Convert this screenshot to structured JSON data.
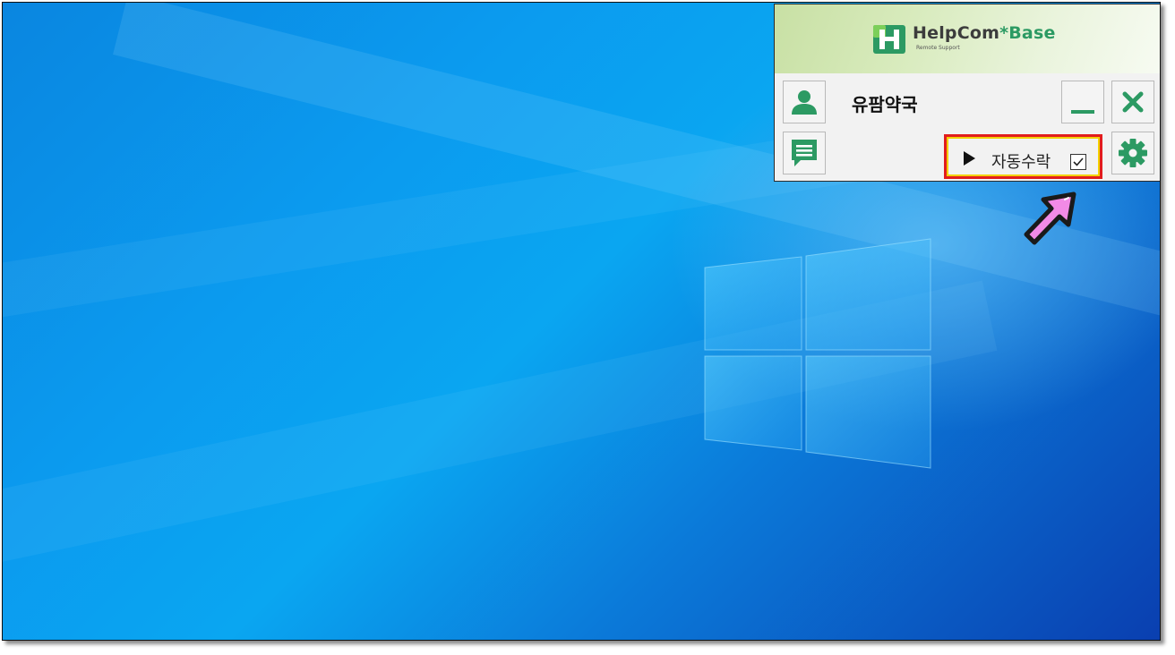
{
  "desktop": {
    "wallpaper": "windows-10-hero",
    "colors": {
      "base": "#0a9cef",
      "deep": "#0a3fb0",
      "glow": "#7fd3ff"
    }
  },
  "widget": {
    "brand": {
      "name_main": "HelpCom",
      "name_star": "*",
      "name_tail": "Base",
      "tagline": "Remote Support",
      "accent": "#2c9a63"
    },
    "store_name": "유팜약국",
    "auto_accept": {
      "label": "자동수락",
      "checked": true
    },
    "icons": {
      "user": "user-icon",
      "chat": "chat-icon",
      "minimize": "minimize-icon",
      "close": "close-icon",
      "settings": "gear-icon"
    },
    "highlight_color": "#e21d1d",
    "arrow_color": "#f28ae6"
  }
}
